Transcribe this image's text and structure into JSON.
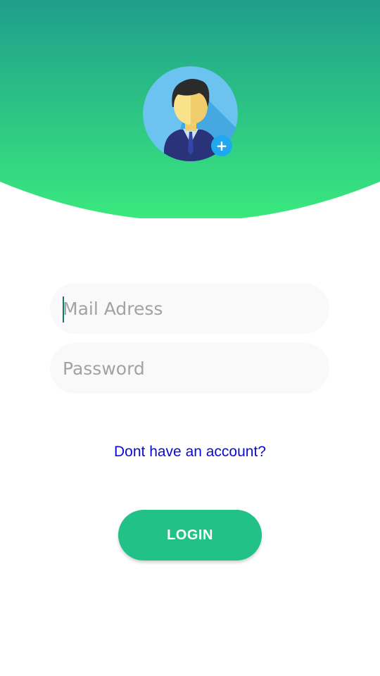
{
  "header": {
    "gradient_top": "#1f9e8c",
    "gradient_bottom": "#3ae97d"
  },
  "avatar": {
    "icon": "user-avatar-icon",
    "add_icon": "plus-icon",
    "add_label": "+"
  },
  "form": {
    "email_placeholder": "Mail Adress",
    "email_value": "",
    "password_placeholder": "Password",
    "password_value": ""
  },
  "links": {
    "signup_label": "Dont have an account?"
  },
  "actions": {
    "login_label": "LOGIN"
  },
  "colors": {
    "accent": "#22c187",
    "link": "#0b0bd6",
    "field_bg": "#f9f9f9",
    "badge": "#1fa8f0"
  }
}
